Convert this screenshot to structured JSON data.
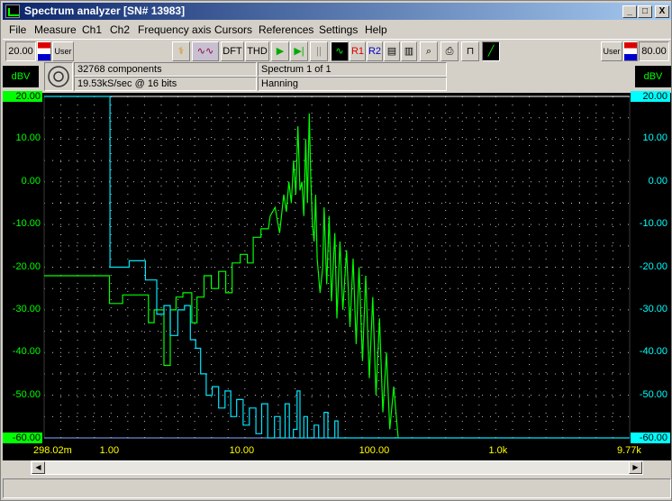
{
  "window": {
    "title": "Spectrum analyzer  [SN# 13983]",
    "min_label": "_",
    "max_label": "□",
    "close_label": "X"
  },
  "menu": [
    "File",
    "Measure",
    "Ch1",
    "Ch2",
    "Frequency axis",
    "Cursors",
    "References",
    "Settings",
    "Help"
  ],
  "toolbar": {
    "left_range": "20.00",
    "left_user": "User",
    "dft_label": "DFT",
    "thd_label": "THD",
    "r1_label": "R1",
    "r2_label": "R2",
    "right_user": "User",
    "right_range": "80.00"
  },
  "info": {
    "components": "32768 components",
    "sample_rate": "19.53kS/sec @ 16 bits",
    "spectrum": "Spectrum 1 of 1",
    "window_fn": "Hanning"
  },
  "axis": {
    "unit_left": "dBV",
    "unit_right": "dBV",
    "left_ticks": [
      "20.00",
      "10.00",
      "0.00",
      "-10.00",
      "-20.00",
      "-30.00",
      "-40.00",
      "-50.00",
      "-60.00"
    ],
    "right_ticks": [
      "20.00",
      "10.00",
      "0.00",
      "-10.00",
      "-20.00",
      "-30.00",
      "-40.00",
      "-50.00",
      "-60.00"
    ],
    "x_ticks": [
      "298.02m",
      "1.00",
      "10.00",
      "100.00",
      "1.0k",
      "9.77k"
    ]
  },
  "colors": {
    "ch1": "#00ff00",
    "ch2": "#00e5ff",
    "grid": "#bdbdbd",
    "top_highlight": "#00ff00",
    "bottom_highlight": "#00ffff"
  },
  "chart_data": {
    "type": "line",
    "xscale": "log",
    "xlim": [
      0.298,
      9770
    ],
    "ylim": [
      -60,
      20
    ],
    "ylabel": "dBV",
    "series": [
      {
        "channel": "Ch1",
        "color": "#00ff00",
        "points": [
          [
            0.298,
            -22
          ],
          [
            0.95,
            -22
          ],
          [
            0.95,
            -28.5
          ],
          [
            1.2,
            -28.5
          ],
          [
            1.2,
            -26.5
          ],
          [
            1.9,
            -26.5
          ],
          [
            1.9,
            -33
          ],
          [
            2.1,
            -33
          ],
          [
            2.1,
            -30
          ],
          [
            2.5,
            -30
          ],
          [
            2.5,
            -43
          ],
          [
            2.8,
            -43
          ],
          [
            2.8,
            -30
          ],
          [
            3.1,
            -30
          ],
          [
            3.1,
            -27
          ],
          [
            3.5,
            -27
          ],
          [
            3.5,
            -26
          ],
          [
            4.1,
            -26
          ],
          [
            4.1,
            -33
          ],
          [
            4.5,
            -33
          ],
          [
            4.5,
            -27
          ],
          [
            5.1,
            -27
          ],
          [
            5.1,
            -22
          ],
          [
            5.8,
            -22
          ],
          [
            5.8,
            -25
          ],
          [
            6.6,
            -25
          ],
          [
            6.6,
            -21
          ],
          [
            7.5,
            -21
          ],
          [
            7.5,
            -26
          ],
          [
            8.4,
            -26
          ],
          [
            8.4,
            -19
          ],
          [
            9.7,
            -19
          ],
          [
            9.7,
            -17
          ],
          [
            11.0,
            -17
          ],
          [
            11.0,
            -19
          ],
          [
            12.2,
            -19
          ],
          [
            12.2,
            -13
          ],
          [
            14.0,
            -13
          ],
          [
            14.0,
            -11
          ],
          [
            16.0,
            -11
          ],
          [
            16.5,
            -8
          ],
          [
            18,
            -6
          ],
          [
            19.5,
            -12
          ],
          [
            21,
            -3
          ],
          [
            22,
            -7
          ],
          [
            23,
            0
          ],
          [
            24,
            -5
          ],
          [
            25,
            5
          ],
          [
            26,
            -3
          ],
          [
            27,
            13
          ],
          [
            28,
            -2
          ],
          [
            29,
            0
          ],
          [
            30,
            -8
          ],
          [
            31,
            10
          ],
          [
            32,
            -5
          ],
          [
            33,
            16
          ],
          [
            34,
            0
          ],
          [
            35,
            -10
          ],
          [
            36,
            -14
          ],
          [
            37,
            -3
          ],
          [
            38,
            -18
          ],
          [
            40,
            -26
          ],
          [
            42,
            -20
          ],
          [
            43,
            -6
          ],
          [
            45,
            -24
          ],
          [
            47,
            -8
          ],
          [
            49,
            -28
          ],
          [
            52,
            -12
          ],
          [
            54,
            -32
          ],
          [
            57,
            -14
          ],
          [
            60,
            -30
          ],
          [
            64,
            -16
          ],
          [
            68,
            -34
          ],
          [
            72,
            -18
          ],
          [
            76,
            -38
          ],
          [
            80,
            -20
          ],
          [
            85,
            -42
          ],
          [
            90,
            -22
          ],
          [
            96,
            -46
          ],
          [
            102,
            -27
          ],
          [
            108,
            -50
          ],
          [
            115,
            -32
          ],
          [
            122,
            -54
          ],
          [
            130,
            -40
          ],
          [
            138,
            -58
          ],
          [
            148,
            -48
          ],
          [
            160,
            -60
          ]
        ]
      },
      {
        "channel": "Ch2",
        "color": "#00e5ff",
        "points": [
          [
            0.298,
            20
          ],
          [
            0.96,
            20
          ],
          [
            0.96,
            -20
          ],
          [
            1.35,
            -20
          ],
          [
            1.35,
            -18.5
          ],
          [
            1.8,
            -18.5
          ],
          [
            1.8,
            -23
          ],
          [
            2.2,
            -23
          ],
          [
            2.2,
            -31
          ],
          [
            2.5,
            -31
          ],
          [
            2.5,
            -29
          ],
          [
            2.8,
            -29
          ],
          [
            2.8,
            -36
          ],
          [
            3.2,
            -36
          ],
          [
            3.2,
            -30
          ],
          [
            3.6,
            -30
          ],
          [
            3.6,
            -29
          ],
          [
            4.0,
            -29
          ],
          [
            4.0,
            -37
          ],
          [
            4.4,
            -37
          ],
          [
            4.4,
            -39
          ],
          [
            4.8,
            -39
          ],
          [
            4.8,
            -45
          ],
          [
            5.3,
            -45
          ],
          [
            5.3,
            -50
          ],
          [
            5.9,
            -50
          ],
          [
            5.9,
            -48
          ],
          [
            6.6,
            -48
          ],
          [
            6.6,
            -53
          ],
          [
            7.4,
            -53
          ],
          [
            7.4,
            -49
          ],
          [
            8.2,
            -49
          ],
          [
            8.2,
            -55
          ],
          [
            9.1,
            -55
          ],
          [
            9.1,
            -51
          ],
          [
            10.2,
            -51
          ],
          [
            10.2,
            -57
          ],
          [
            11.4,
            -57
          ],
          [
            11.4,
            -53
          ],
          [
            12.8,
            -53
          ],
          [
            12.8,
            -59
          ],
          [
            14.2,
            -59
          ],
          [
            14.2,
            -52
          ],
          [
            15.8,
            -52
          ],
          [
            15.8,
            -60
          ],
          [
            17.8,
            -60
          ],
          [
            17.8,
            -55
          ],
          [
            19.7,
            -55
          ],
          [
            19.7,
            -60
          ],
          [
            21.5,
            -60
          ],
          [
            21.5,
            -52
          ],
          [
            23.2,
            -52
          ],
          [
            23.2,
            -60
          ],
          [
            24.9,
            -60
          ],
          [
            24.9,
            -58
          ],
          [
            26.6,
            -58
          ],
          [
            26.6,
            -49
          ],
          [
            28.0,
            -49
          ],
          [
            28.0,
            -60
          ],
          [
            30.0,
            -60
          ],
          [
            30.0,
            -55
          ],
          [
            32.0,
            -55
          ],
          [
            32.0,
            -60
          ],
          [
            36.0,
            -60
          ],
          [
            36.0,
            -57
          ],
          [
            39.0,
            -57
          ],
          [
            39.0,
            -60
          ],
          [
            43.0,
            -60
          ],
          [
            43.0,
            -54
          ],
          [
            46.0,
            -54
          ],
          [
            46.0,
            -60
          ],
          [
            52.0,
            -60
          ],
          [
            52.0,
            -56
          ],
          [
            55.0,
            -56
          ],
          [
            55.0,
            -60
          ],
          [
            9770,
            -60
          ]
        ]
      }
    ]
  }
}
